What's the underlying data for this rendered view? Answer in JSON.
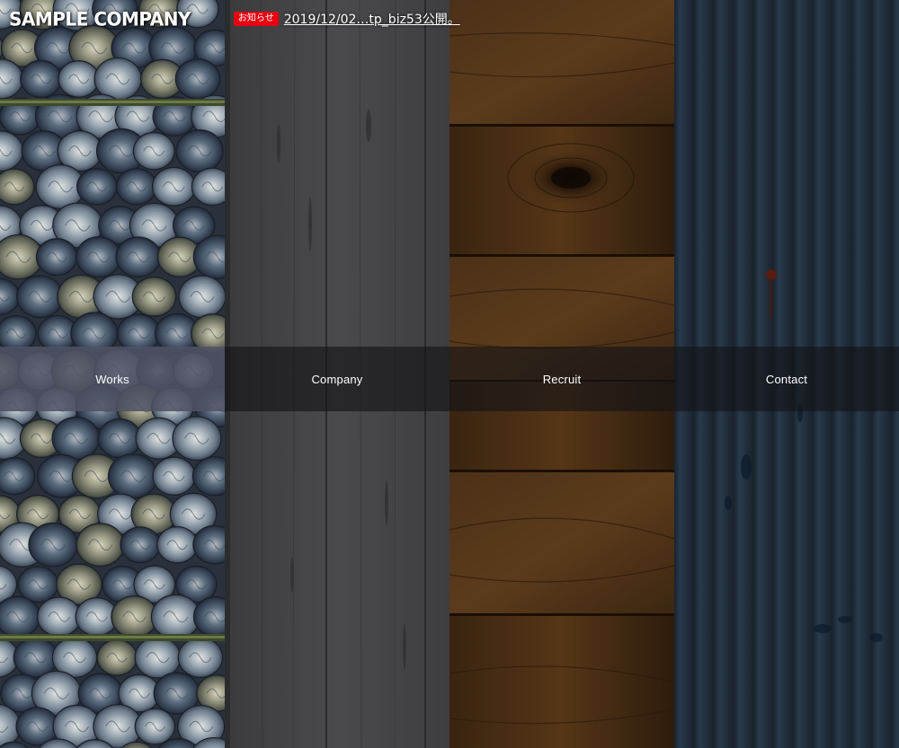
{
  "header": {
    "logo_text": "SAMPLE COMPANY",
    "news_badge": "お知らせ",
    "news_text": "2019/12/02…tp_biz53公開。"
  },
  "menu": {
    "items": [
      {
        "label": "Works",
        "active": true
      },
      {
        "label": "Company",
        "active": false
      },
      {
        "label": "Recruit",
        "active": false
      },
      {
        "label": "Contact",
        "active": false
      }
    ]
  },
  "colors": {
    "badge_red": "#e60012",
    "menu_active": "#4e5264",
    "menu_bg": "#141416",
    "denim": "#8a98a8",
    "grey_wood": "#4a4a4c",
    "brown_wood": "#4a2e14",
    "blue_metal": "#2a3a48"
  },
  "panels": [
    {
      "texture": "denim-rolls"
    },
    {
      "texture": "grey-wood-planks"
    },
    {
      "texture": "brown-wood-boards"
    },
    {
      "texture": "corrugated-blue-metal"
    }
  ]
}
